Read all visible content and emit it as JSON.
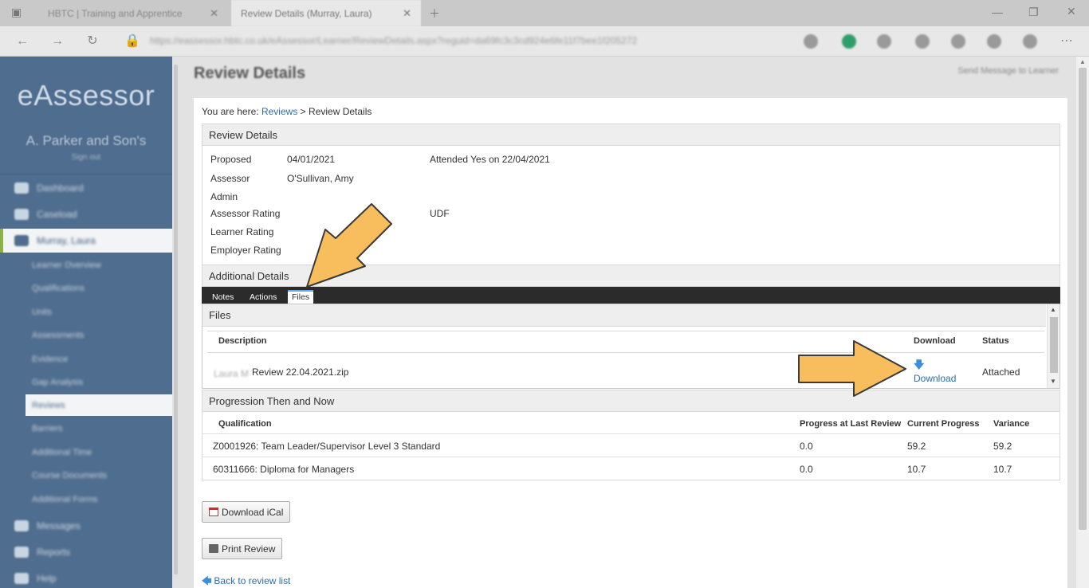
{
  "browser": {
    "tabs": [
      {
        "label": "HBTC | Training and Apprentice",
        "active": false
      },
      {
        "label": "Review Details (Murray, Laura)",
        "active": true
      }
    ],
    "url": "https://eassessor.hbtc.co.uk/eAssessor/Learner/ReviewDetails.aspx?reguid=da69fc3c3cd924e6fe11f7bee1f205272"
  },
  "sidebar": {
    "brand": "eAssessor",
    "company": "A. Parker and Son's",
    "signout": "Sign out",
    "items": [
      {
        "label": "Dashboard",
        "icon": "dashboard-icon"
      },
      {
        "label": "Caseload",
        "icon": "caseload-icon"
      },
      {
        "label": "Murray, Laura",
        "icon": "learner-icon"
      }
    ],
    "subitems": [
      "Learner Overview",
      "Qualifications",
      "Units",
      "Assessments",
      "Evidence",
      "Gap Analysis",
      "Reviews",
      "Barriers",
      "Additional Time",
      "Course Documents",
      "Additional Forms"
    ],
    "bottom_items": [
      {
        "label": "Messages",
        "icon": "messages-icon"
      },
      {
        "label": "Reports",
        "icon": "reports-icon"
      },
      {
        "label": "Help",
        "icon": "help-icon"
      }
    ]
  },
  "page": {
    "title": "Review Details",
    "send_message": "Send Message to Learner",
    "breadcrumb_prefix": "You are here:",
    "breadcrumb_link": "Reviews",
    "breadcrumb_sep": ">",
    "breadcrumb_current": "Review Details"
  },
  "review_details": {
    "heading": "Review Details",
    "proposed_label": "Proposed",
    "proposed_value": "04/01/2021",
    "attended": "Attended Yes on 22/04/2021",
    "assessor_label": "Assessor",
    "assessor_value": "O'Sullivan, Amy",
    "admin_label": "Admin",
    "assessor_rating_label": "Assessor Rating",
    "assessor_rating_value": "UDF",
    "learner_rating_label": "Learner Rating",
    "employer_rating_label": "Employer Rating"
  },
  "additional_details": {
    "heading": "Additional Details",
    "tabs": [
      "Notes",
      "Actions",
      "Files"
    ],
    "active_tab": "Files"
  },
  "files": {
    "heading": "Files",
    "columns": [
      "Description",
      "Download",
      "Status"
    ],
    "rows": [
      {
        "prefix": "Laura M",
        "description": "Review 22.04.2021.zip",
        "download": "Download",
        "status": "Attached"
      }
    ]
  },
  "progression": {
    "heading": "Progression Then and Now",
    "columns": [
      "Qualification",
      "Progress at Last Review",
      "Current Progress",
      "Variance"
    ],
    "rows": [
      {
        "qualification": "Z0001926: Team Leader/Supervisor Level 3 Standard",
        "last": "0.0",
        "current": "59.2",
        "variance": "59.2"
      },
      {
        "qualification": "60311666: Diploma for Managers",
        "last": "0.0",
        "current": "10.7",
        "variance": "10.7"
      }
    ]
  },
  "buttons": {
    "ical": "Download iCal",
    "print": "Print Review",
    "back": "Back to review list"
  },
  "colors": {
    "sidebar": "#4f6d8e",
    "link": "#2a6db0",
    "annotation_arrow": "#f8bd5c"
  }
}
